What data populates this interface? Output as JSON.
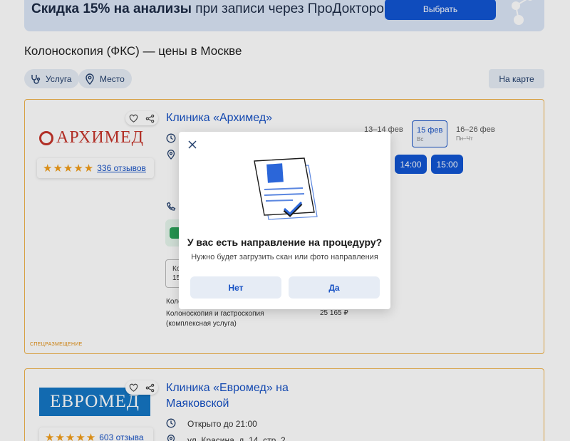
{
  "banner": {
    "headline_bold": "Скидка 15% на анализы",
    "headline_rest": " при записи через ПроДокторов",
    "button_label": "Выбрать"
  },
  "page_title": "Колоноскопия (ФКС) — цены в Москве",
  "filters": {
    "service_label": "Услуга",
    "place_label": "Место",
    "map_label": "На карте"
  },
  "clinic1": {
    "logo_text": "АРХИМЕД",
    "name": "Клиника «Архимед»",
    "reviews_link": "336 отзывов",
    "stars": "★★★★★",
    "dates": [
      {
        "label": "13–14 фев",
        "sub": ""
      },
      {
        "label": "15 фев",
        "sub": "Вс"
      },
      {
        "label": "16–26 фев",
        "sub": "Пн–Чт"
      }
    ],
    "times": [
      "14:00",
      "15:00"
    ],
    "service_box": "Ко\n15",
    "service_rows": [
      {
        "name": "Коло",
        "price": ""
      },
      {
        "name": "Колоноскопия и гастроскопия (комплексная услуга)",
        "price": "25 165 ₽"
      }
    ],
    "placement_label": "Спецразмещение"
  },
  "clinic2": {
    "logo_text": "ЕВРОМЕД",
    "name": "Клиника «Евромед» на Маяковской",
    "reviews_link": "603 отзыва",
    "stars": "★★★★★",
    "hours": "Открыто до 21:00",
    "address": "ул. Красина, д. 14, стр. 2"
  },
  "modal": {
    "title": "У вас есть направление на процедуру?",
    "subtitle": "Нужно будет загрузить скан или фото направления",
    "no_label": "Нет",
    "yes_label": "Да"
  },
  "colors": {
    "accent": "#1155d3",
    "link": "#1651c4",
    "card_border": "#f0b34a",
    "star": "#f29e1a"
  }
}
